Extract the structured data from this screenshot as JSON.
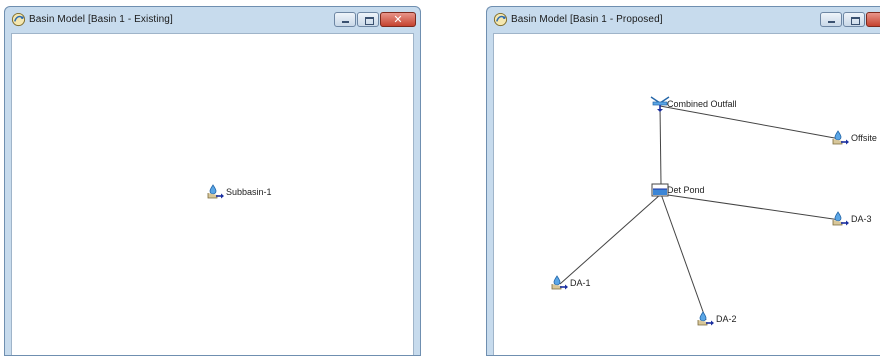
{
  "windows": [
    {
      "title": "Basin Model [Basin 1 - Existing]",
      "nodes": [
        {
          "label": "Subbasin-1",
          "icon": "subbasin-icon"
        }
      ]
    },
    {
      "title": "Basin Model [Basin 1 - Proposed]",
      "nodes": [
        {
          "label": "Combined Outfall",
          "icon": "junction-icon"
        },
        {
          "label": "Offsite",
          "icon": "subbasin-icon"
        },
        {
          "label": "Det Pond",
          "icon": "reservoir-icon"
        },
        {
          "label": "DA-3",
          "icon": "subbasin-icon"
        },
        {
          "label": "DA-1",
          "icon": "subbasin-icon"
        },
        {
          "label": "DA-2",
          "icon": "subbasin-icon"
        }
      ]
    }
  ],
  "window_controls": {
    "close_symbol": "✕"
  },
  "colors": {
    "frame": "#c7dbed",
    "close_button": "#c5432f",
    "link_line": "#444444"
  }
}
